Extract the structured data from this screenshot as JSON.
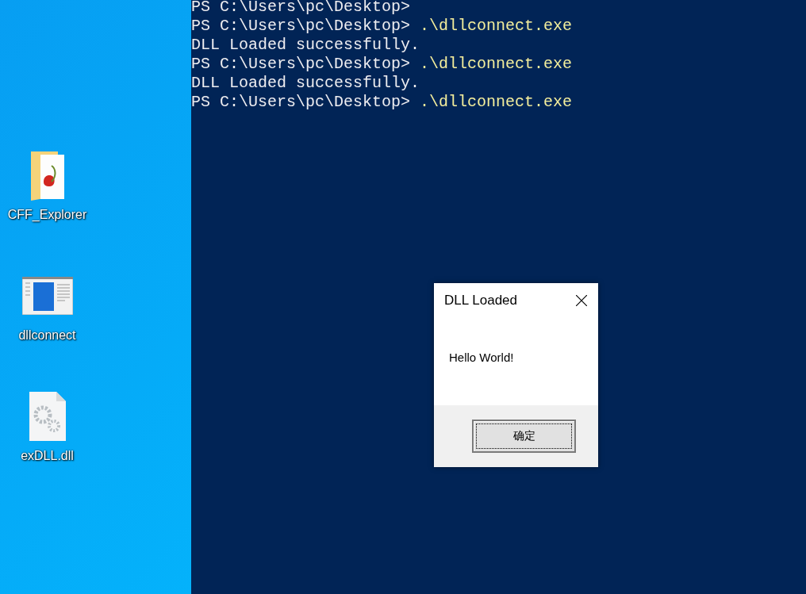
{
  "desktop": {
    "icons": [
      {
        "kind": "folder",
        "label": "CFF_Explorer"
      },
      {
        "kind": "app",
        "label": "dllconnect"
      },
      {
        "kind": "dll",
        "label": "exDLL.dll"
      }
    ]
  },
  "console": {
    "lines": [
      {
        "kind": "prompt",
        "prompt": "PS C:\\Users\\pc\\Desktop>"
      },
      {
        "kind": "prompt",
        "prompt": "PS C:\\Users\\pc\\Desktop>",
        "command": ".\\dllconnect.exe"
      },
      {
        "kind": "output",
        "text": "DLL Loaded successfully."
      },
      {
        "kind": "prompt",
        "prompt": "PS C:\\Users\\pc\\Desktop>",
        "command": ".\\dllconnect.exe"
      },
      {
        "kind": "output",
        "text": "DLL Loaded successfully."
      },
      {
        "kind": "prompt",
        "prompt": "PS C:\\Users\\pc\\Desktop>",
        "command": ".\\dllconnect.exe"
      }
    ]
  },
  "dialog": {
    "title": "DLL Loaded",
    "message": "Hello World!",
    "button": "确定"
  }
}
